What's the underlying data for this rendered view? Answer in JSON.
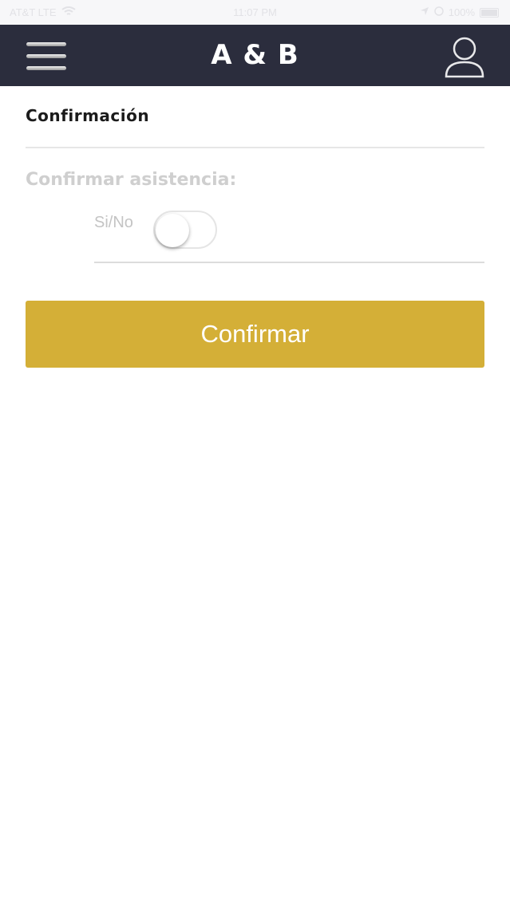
{
  "status_bar": {
    "carrier": "AT&T LTE",
    "time": "11:07 PM",
    "battery": "100%"
  },
  "header": {
    "title": "A & B",
    "menu_icon": "hamburger-menu-icon",
    "profile_icon": "user-profile-icon",
    "background_color": "#2b2d3d"
  },
  "section": {
    "title": "Confirmación"
  },
  "attendance": {
    "label": "Confirmar asistencia:",
    "toggle_label": "Si/No",
    "toggle_on": false
  },
  "confirm_button": {
    "label": "Confirmar",
    "color": "#d4af37"
  }
}
